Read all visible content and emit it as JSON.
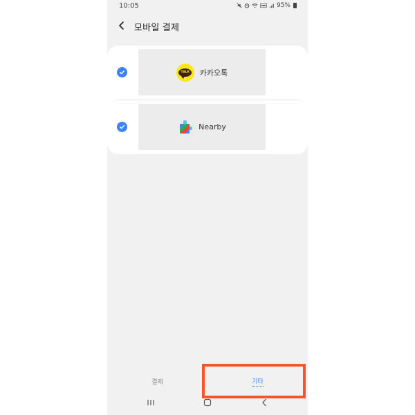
{
  "status_bar": {
    "time": "10:05",
    "icons": [
      "mute-icon",
      "alarm-icon",
      "wifi-icon",
      "lte-icon",
      "signal-icon"
    ],
    "battery": "95%"
  },
  "header": {
    "title": "모바일 결제"
  },
  "apps": [
    {
      "label": "카카오톡",
      "icon": "kakaotalk-icon",
      "checked": true
    },
    {
      "label": "Nearby",
      "icon": "nearby-icon",
      "checked": true
    }
  ],
  "tabs": {
    "payment": "결제",
    "other": "기타",
    "active": "other"
  },
  "colors": {
    "accent": "#3e82f7",
    "highlight": "#f4562c",
    "kakao_yellow": "#ffe812",
    "background": "#f1f1f1"
  }
}
